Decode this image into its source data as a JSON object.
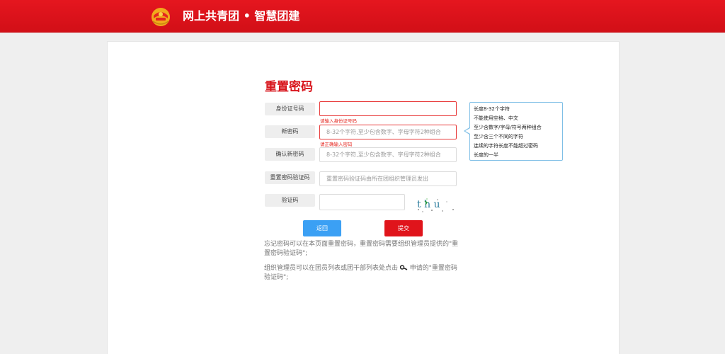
{
  "header": {
    "brand": "网上共青团 • 智慧团建",
    "colors": {
      "bar": "#d8141b",
      "logo": "#f1a91c"
    }
  },
  "form": {
    "title": "重置密码",
    "fields": [
      {
        "label": "身份证号码",
        "value": "",
        "placeholder": "",
        "error": "请输入身份证号码"
      },
      {
        "label": "新密码",
        "value": "",
        "placeholder": "8-32个字符,至少包含数字、字母字符2种组合",
        "error": "请正确输入密码"
      },
      {
        "label": "确认新密码",
        "value": "",
        "placeholder": "8-32个字符,至少包含数字、字母字符2种组合",
        "error": ""
      },
      {
        "label": "重置密码验证码",
        "value": "",
        "placeholder": "重置密码验证码由所在团组织管理员发出",
        "error": ""
      },
      {
        "label": "验证码",
        "value": "",
        "placeholder": "",
        "error": ""
      }
    ],
    "captcha_text": "t h u",
    "tip_lines": [
      "长度8-32个字符",
      "不能使用空格、中文",
      "至少含数字/字母/符号两种组合",
      "至少含三个不同的字符",
      "连续的字符长度不能超过密码",
      "长度的一半"
    ],
    "back_button": "返回",
    "submit_button": "提交",
    "note1": "忘记密码可以在本页面重置密码，重置密码需要组织管理员提供的\"重置密码验证码\";",
    "note2_prefix": "组织管理员可以在团员列表或团干部列表处点击",
    "note2_suffix": "申请的\"重置密码验证码\";",
    "key_icon": "key-icon",
    "colors": {
      "accent": "#d8141b",
      "back": "#3ba0f4",
      "submit": "#e0141b",
      "error": "#e5261f",
      "tip_border": "#7fbfe6"
    }
  }
}
